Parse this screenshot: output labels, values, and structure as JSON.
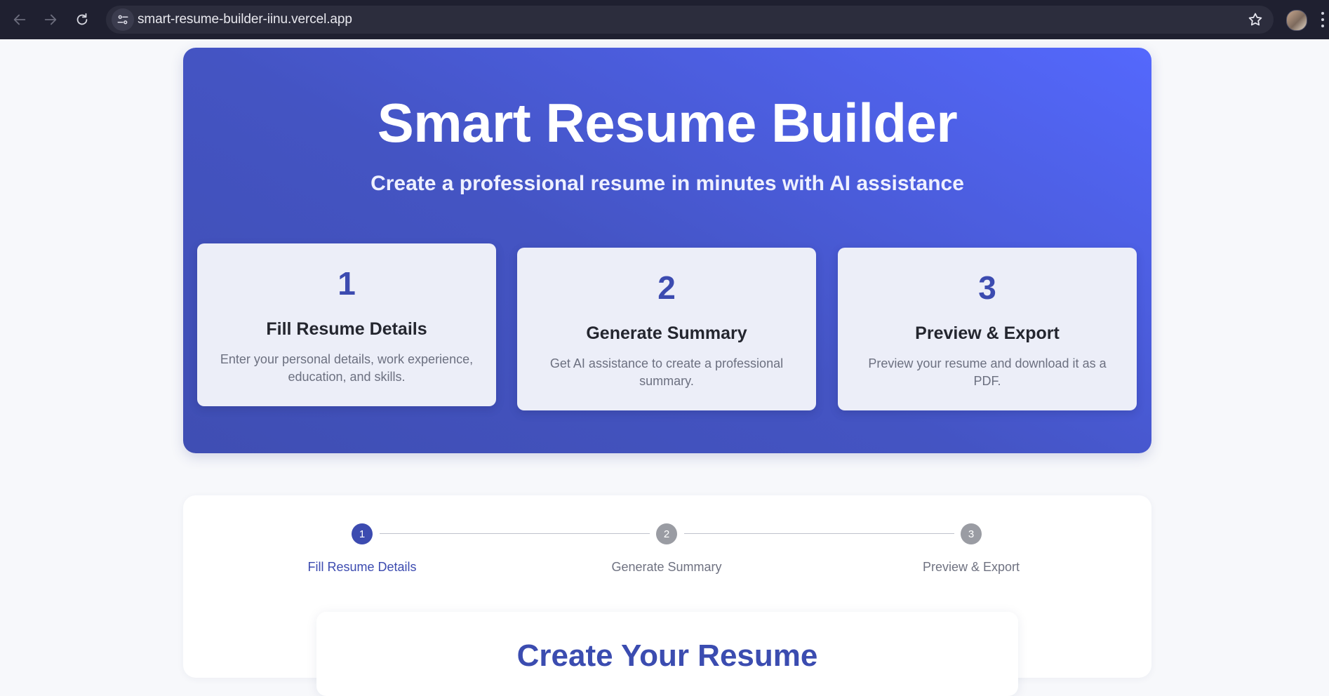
{
  "browser": {
    "url": "smart-resume-builder-iinu.vercel.app"
  },
  "hero": {
    "title": "Smart Resume Builder",
    "subtitle": "Create a professional resume in minutes with AI assistance",
    "steps": [
      {
        "number": "1",
        "title": "Fill Resume Details",
        "description": "Enter your personal details, work experience, education, and skills."
      },
      {
        "number": "2",
        "title": "Generate Summary",
        "description": "Get AI assistance to create a professional summary."
      },
      {
        "number": "3",
        "title": "Preview & Export",
        "description": "Preview your resume and download it as a PDF."
      }
    ]
  },
  "stepper": {
    "steps": [
      {
        "number": "1",
        "label": "Fill Resume Details",
        "active": true
      },
      {
        "number": "2",
        "label": "Generate Summary",
        "active": false
      },
      {
        "number": "3",
        "label": "Preview & Export",
        "active": false
      }
    ]
  },
  "form": {
    "title": "Create Your Resume"
  },
  "colors": {
    "accent": "#3c4bb0",
    "inactive_step": "#9a9ca3",
    "hero_gradient_start": "#3f4eb3",
    "hero_gradient_end": "#5468fd"
  }
}
